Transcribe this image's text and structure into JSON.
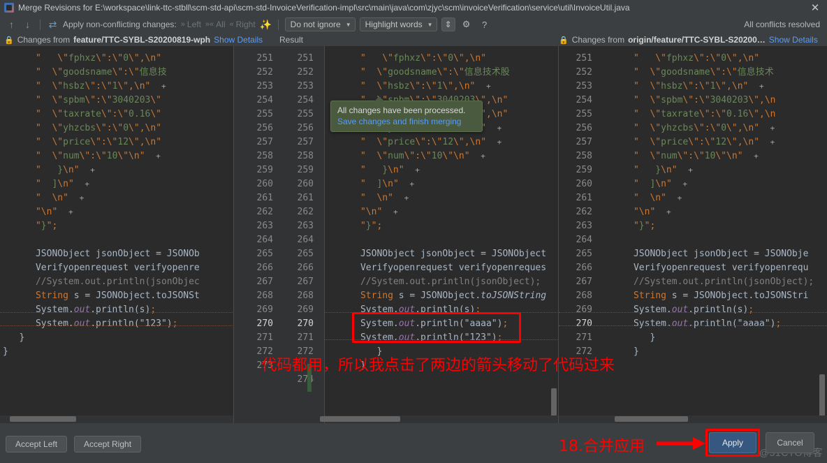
{
  "window": {
    "title": "Merge Revisions for E:\\workspace\\link-ttc-stbll\\scm-std-api\\scm-std-InvoiceVerification-impl\\src\\main\\java\\com\\zjyc\\scm\\invoiceVerification\\service\\util\\InvoiceUtil.java",
    "close_label": "✕"
  },
  "toolbar": {
    "prev_icon": "↑",
    "next_icon": "↓",
    "apply_icon": "⇄",
    "apply_label": "Apply non-conflicting changes:",
    "left_label": "Left",
    "all_label": "All",
    "right_label": "Right",
    "magic_icon": "✨",
    "ignore_select": "Do not ignore",
    "highlight_select": "Highlight words",
    "collapse_icon": "⇕",
    "settings_icon": "⚙",
    "help_icon": "?",
    "status": "All conflicts resolved"
  },
  "headers": {
    "left": {
      "lock": "🔒",
      "prefix": "Changes from",
      "branch": "feature/TTC-SYBL-S20200819-wph",
      "details": "Show Details"
    },
    "middle": {
      "label": "Result"
    },
    "right": {
      "lock": "🔒",
      "prefix": "Changes from",
      "branch": "origin/feature/TTC-SYBL-S20200…",
      "details": "Show Details"
    }
  },
  "popup": {
    "line1": "All changes have been processed.",
    "line2": "Save changes and finish merging"
  },
  "annotations": {
    "code_note": "代码都用，所以我点击了两边的箭头移动了代码过来",
    "apply_note": "18.合并应用",
    "watermark": "@51CTO博客"
  },
  "buttons": {
    "accept_left": "Accept Left",
    "accept_right": "Accept Right",
    "apply": "Apply",
    "cancel": "Cancel"
  },
  "code": {
    "left_lines": [
      "      \"   \\\"fphxz\\\":\\\"0\\\",\\n\"",
      "      \"  \\\"goodsname\\\":\\\"信息技",
      "      \"  \\\"hsbz\\\":\\\"1\\\",\\n\"  +",
      "      \"  \\\"spbm\\\":\\\"3040203\\\"",
      "      \"  \\\"taxrate\\\":\\\"0.16\\\"",
      "      \"  \\\"yhzcbs\\\":\\\"0\\\",\\n\"",
      "      \"  \\\"price\\\":\\\"12\\\",\\n\"",
      "      \"  \\\"num\\\":\\\"10\\\"\\n\"  +",
      "      \"   }\\n\"  +",
      "      \"  ]\\n\"  +",
      "      \"  \\n\"  +",
      "      \"\\n\"  +",
      "      \"}\";",
      "",
      "      JSONObject jsonObject = JSONOb",
      "      Verifyopenrequest verifyopenre",
      "      //System.out.println(jsonObjec",
      "      String s = JSONObject.toJSONSt",
      "      System.out.println(s);",
      "      System.out.println(\"123\");",
      "   }",
      "}"
    ],
    "mid_lines": [
      "      \"   \\\"fphxz\\\":\\\"0\\\",\\n\"",
      "      \"  \\\"goodsname\\\":\\\"信息技术股",
      "      \"  \\\"hsbz\\\":\\\"1\\\",\\n\"  +",
      "      \"  \\\"spbm\\\":\\\"3040203\\\",\\n\"",
      "      \"  \\\"taxrate\\\":\\\"0.16\\\",\\n\"",
      "      \"  \\\"yhzcbs\\\":\\\"0\\\",\\n\"  +",
      "      \"  \\\"price\\\":\\\"12\\\",\\n\"  +",
      "      \"  \\\"num\\\":\\\"10\\\"\\n\"  +",
      "      \"   }\\n\"  +",
      "      \"  ]\\n\"  +",
      "      \"  \\n\"  +",
      "      \"\\n\"  +",
      "      \"}\";",
      "",
      "      JSONObject jsonObject = JSONObject",
      "      Verifyopenrequest verifyopenreques",
      "      //System.out.println(jsonObject);",
      "      String s = JSONObject.toJSONString",
      "      System.out.println(s);",
      "      System.out.println(\"aaaa\");",
      "      System.out.println(\"123\");",
      "         }",
      "      }"
    ],
    "right_lines": [
      "      \"   \\\"fphxz\\\":\\\"0\\\",\\n\"",
      "      \"  \\\"goodsname\\\":\\\"信息技术",
      "      \"  \\\"hsbz\\\":\\\"1\\\",\\n\"  +",
      "      \"  \\\"spbm\\\":\\\"3040203\\\",\\n",
      "      \"  \\\"taxrate\\\":\\\"0.16\\\",\\n",
      "      \"  \\\"yhzcbs\\\":\\\"0\\\",\\n\"  +",
      "      \"  \\\"price\\\":\\\"12\\\",\\n\"  +",
      "      \"  \\\"num\\\":\\\"10\\\"\\n\"  +",
      "      \"   }\\n\"  +",
      "      \"  ]\\n\"  +",
      "      \"  \\n\"  +",
      "      \"\\n\"  +",
      "      \"}\";",
      "",
      "      JSONObject jsonObject = JSONObje",
      "      Verifyopenrequest verifyopenrequ",
      "      //System.out.println(jsonObject);",
      "      String s = JSONObject.toJSONStri",
      "      System.out.println(s);",
      "      System.out.println(\"aaaa\");",
      "         }",
      "      }"
    ],
    "line_numbers_left_col": [
      "251",
      "252",
      "253",
      "254",
      "255",
      "256",
      "257",
      "258",
      "259",
      "260",
      "261",
      "262",
      "263",
      "264",
      "265",
      "266",
      "267",
      "268",
      "269",
      "270",
      "271",
      "272",
      "273",
      ""
    ],
    "line_numbers_right_col": [
      "251",
      "252",
      "253",
      "254",
      "255",
      "256",
      "257",
      "258",
      "259",
      "260",
      "261",
      "262",
      "263",
      "264",
      "265",
      "266",
      "267",
      "268",
      "269",
      "270",
      "271",
      "272",
      "",
      "274"
    ],
    "line_numbers_far_right": [
      "251",
      "252",
      "253",
      "254",
      "255",
      "256",
      "257",
      "258",
      "259",
      "260",
      "261",
      "262",
      "263",
      "264",
      "265",
      "266",
      "267",
      "268",
      "269",
      "270",
      "271",
      "272"
    ],
    "current_line": "270"
  },
  "colors": {
    "accent_blue": "#365880",
    "link_blue": "#589df6",
    "annotation_red": "#ff0000",
    "string_green": "#6a8759",
    "escape_orange": "#cc7832",
    "bg_editor": "#2b2b2b",
    "bg_chrome": "#3c3f41"
  }
}
